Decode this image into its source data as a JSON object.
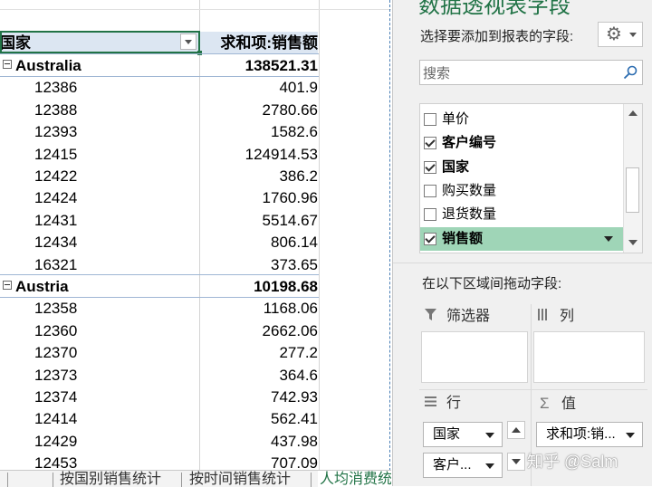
{
  "pivot": {
    "header": {
      "row_label": "国家",
      "value_label": "求和项:销售额"
    },
    "rows": [
      {
        "type": "country",
        "label": "Australia",
        "value": "138521.31"
      },
      {
        "type": "child",
        "label": "12386",
        "value": "401.9"
      },
      {
        "type": "child",
        "label": "12388",
        "value": "2780.66"
      },
      {
        "type": "child",
        "label": "12393",
        "value": "1582.6"
      },
      {
        "type": "child",
        "label": "12415",
        "value": "124914.53"
      },
      {
        "type": "child",
        "label": "12422",
        "value": "386.2"
      },
      {
        "type": "child",
        "label": "12424",
        "value": "1760.96"
      },
      {
        "type": "child",
        "label": "12431",
        "value": "5514.67"
      },
      {
        "type": "child",
        "label": "12434",
        "value": "806.14"
      },
      {
        "type": "child",
        "label": "16321",
        "value": "373.65"
      },
      {
        "type": "country",
        "label": "Austria",
        "value": "10198.68"
      },
      {
        "type": "child",
        "label": "12358",
        "value": "1168.06"
      },
      {
        "type": "child",
        "label": "12360",
        "value": "2662.06"
      },
      {
        "type": "child",
        "label": "12370",
        "value": "277.2"
      },
      {
        "type": "child",
        "label": "12373",
        "value": "364.6"
      },
      {
        "type": "child",
        "label": "12374",
        "value": "742.93"
      },
      {
        "type": "child",
        "label": "12414",
        "value": "562.41"
      },
      {
        "type": "child",
        "label": "12429",
        "value": "437.98"
      },
      {
        "type": "child",
        "label": "12453",
        "value": "707.09"
      }
    ]
  },
  "sheet_tabs": [
    {
      "label": "按国别销售统计",
      "active": false
    },
    {
      "label": "按时间销售统计",
      "active": false
    },
    {
      "label": "人均消费统",
      "active": true
    }
  ],
  "panel": {
    "title": "数据透视表字段",
    "choose_label": "选择要添加到报表的字段:",
    "gear_icon": "gear-icon",
    "search_placeholder": "搜索",
    "fields": [
      {
        "label": "单价",
        "checked": false
      },
      {
        "label": "客户编号",
        "checked": true
      },
      {
        "label": "国家",
        "checked": true
      },
      {
        "label": "购买数量",
        "checked": false
      },
      {
        "label": "退货数量",
        "checked": false
      },
      {
        "label": "销售额",
        "checked": true,
        "highlighted": true
      }
    ],
    "drag_label": "在以下区域间拖动字段:",
    "areas": {
      "filter": {
        "label": "筛选器",
        "icon": "filter-icon"
      },
      "columns": {
        "label": "列",
        "icon": "columns-icon"
      },
      "rows": {
        "label": "行",
        "icon": "rows-icon",
        "items": [
          "国家",
          "客户..."
        ]
      },
      "values": {
        "label": "值",
        "icon": "sigma-icon",
        "items": [
          "求和项:销..."
        ]
      }
    }
  },
  "watermark": "知乎 @Salm",
  "colors": {
    "accent": "#217346",
    "highlight": "#9fd5b7",
    "header_fill": "#dce6f2"
  }
}
